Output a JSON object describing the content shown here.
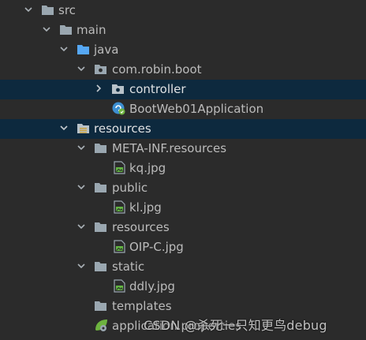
{
  "tree": {
    "nodes": [
      {
        "label": "src",
        "icon": "folder",
        "expanded": true
      },
      {
        "label": "main",
        "icon": "folder",
        "expanded": true
      },
      {
        "label": "java",
        "icon": "source-folder",
        "expanded": true
      },
      {
        "label": "com.robin.boot",
        "icon": "package",
        "expanded": true
      },
      {
        "label": "controller",
        "icon": "package",
        "expanded": false,
        "selected": true
      },
      {
        "label": "BootWeb01Application",
        "icon": "spring-boot-class"
      },
      {
        "label": "resources",
        "icon": "resources-folder",
        "expanded": true,
        "selected": true
      },
      {
        "label": "META-INF.resources",
        "icon": "folder",
        "expanded": true
      },
      {
        "label": "kq.jpg",
        "icon": "image-file"
      },
      {
        "label": "public",
        "icon": "folder",
        "expanded": true
      },
      {
        "label": "kl.jpg",
        "icon": "image-file"
      },
      {
        "label": "resources",
        "icon": "folder",
        "expanded": true
      },
      {
        "label": "OIP-C.jpg",
        "icon": "image-file"
      },
      {
        "label": "static",
        "icon": "folder",
        "expanded": true
      },
      {
        "label": "ddly.jpg",
        "icon": "image-file"
      },
      {
        "label": "templates",
        "icon": "folder"
      },
      {
        "label": "application.properties",
        "icon": "spring-properties-file"
      }
    ]
  },
  "watermark": "CSDN @杀死一只知更鸟debug",
  "colors": {
    "background": "#2b2b2b",
    "selection": "#0d293e",
    "text": "#bbbbbb",
    "folder": "#9aa7b0",
    "source_folder": "#56a8f5",
    "image_file_accent": "#62b543",
    "spring": "#6db33f"
  }
}
